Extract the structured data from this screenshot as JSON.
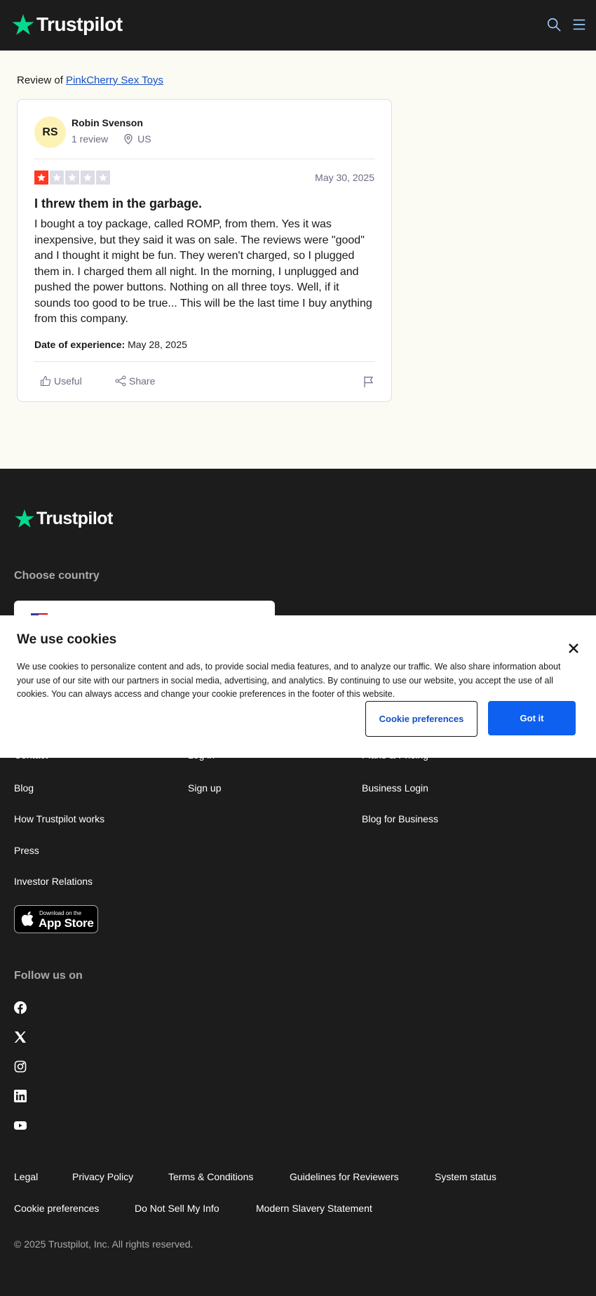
{
  "header": {
    "logo_text": "Trustpilot",
    "icons": [
      "search-icon",
      "menu-icon"
    ]
  },
  "main": {
    "review_of_prefix": "Review of",
    "company_link": "PinkCherry Sex Toys"
  },
  "review": {
    "avatar_initials": "RS",
    "reviewer_name": "Robin Svenson",
    "review_count": "1 review",
    "country": "US",
    "rating": 1,
    "max_rating": 5,
    "date": "May 30, 2025",
    "title": "I threw them in the garbage.",
    "body": "I bought a toy package, called ROMP, from them. Yes it was inexpensive, but they said it was on sale. The reviews were \"good\" and I thought it might be fun. They weren't charged, so I plugged them in. I charged them all night. In the morning, I unplugged and pushed the power buttons. Nothing on all three toys. Well, if it sounds too good to be true... This will be the last time I buy anything from this company.",
    "experience_label": "Date of experience:",
    "experience_date": "May 28, 2025",
    "useful_label": "Useful",
    "share_label": "Share"
  },
  "footer": {
    "logo_text": "Trustpilot",
    "choose_country": "Choose country",
    "col1": [
      "Contact",
      "Blog",
      "How Trustpilot works",
      "Press",
      "Investor Relations"
    ],
    "col2": [
      "Log in",
      "Sign up"
    ],
    "col3": [
      "Plans & Pricing",
      "Business Login",
      "Blog for Business"
    ],
    "appstore_small": "Download on the",
    "appstore_big": "App Store",
    "follow_us": "Follow us on",
    "social": [
      "facebook-icon",
      "x-icon",
      "instagram-icon",
      "linkedin-icon",
      "youtube-icon"
    ],
    "legal_row1": [
      "Legal",
      "Privacy Policy",
      "Terms & Conditions",
      "Guidelines for Reviewers",
      "System status"
    ],
    "legal_row2": [
      "Cookie preferences",
      "Do Not Sell My Info",
      "Modern Slavery Statement"
    ],
    "copyright": "© 2025 Trustpilot, Inc. All rights reserved."
  },
  "cookie": {
    "title": "We use cookies",
    "text": "We use cookies to personalize content and ads, to provide social media features, and to analyze our traffic. We also share information about your use of our site with our partners in social media, advertising, and analytics. By continuing to use our website, you accept the use of all cookies. You can always access and change your cookie preferences in the footer of this website.",
    "preferences_button": "Cookie preferences",
    "accept_button": "Got it"
  },
  "colors": {
    "brand_green": "#04da8d",
    "rating_red": "#ff3722",
    "link_blue": "#1450c8",
    "button_blue": "#0e60f0"
  }
}
